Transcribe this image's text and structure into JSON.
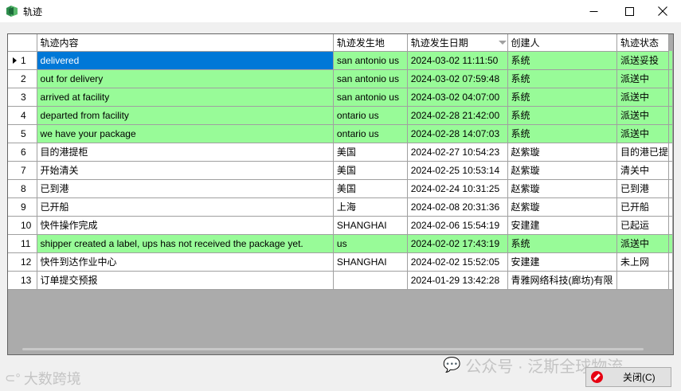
{
  "window": {
    "title": "轨迹"
  },
  "grid": {
    "columns": [
      "轨迹内容",
      "轨迹发生地",
      "轨迹发生日期",
      "创建人",
      "轨迹状态"
    ],
    "rows": [
      {
        "num": "1",
        "content": "delivered",
        "place": "san antonio us",
        "date": "2024-03-02 11:11:50",
        "creator": "系统",
        "status": "派送妥投"
      },
      {
        "num": "2",
        "content": "out for delivery",
        "place": "san antonio us",
        "date": "2024-03-02 07:59:48",
        "creator": "系统",
        "status": "派送中"
      },
      {
        "num": "3",
        "content": "arrived at facility",
        "place": "san antonio us",
        "date": "2024-03-02 04:07:00",
        "creator": "系统",
        "status": "派送中"
      },
      {
        "num": "4",
        "content": "departed from facility",
        "place": "ontario us",
        "date": "2024-02-28 21:42:00",
        "creator": "系统",
        "status": "派送中"
      },
      {
        "num": "5",
        "content": "we have your package",
        "place": "ontario us",
        "date": "2024-02-28 14:07:03",
        "creator": "系统",
        "status": "派送中"
      },
      {
        "num": "6",
        "content": "目的港提柜",
        "place": "美国",
        "date": "2024-02-27 10:54:23",
        "creator": "赵紫璇",
        "status": "目的港已提"
      },
      {
        "num": "7",
        "content": "开始清关",
        "place": "美国",
        "date": "2024-02-25 10:53:14",
        "creator": "赵紫璇",
        "status": "清关中"
      },
      {
        "num": "8",
        "content": "已到港",
        "place": "美国",
        "date": "2024-02-24 10:31:25",
        "creator": "赵紫璇",
        "status": "已到港"
      },
      {
        "num": "9",
        "content": "已开船",
        "place": "上海",
        "date": "2024-02-08 20:31:36",
        "creator": "赵紫璇",
        "status": "已开船"
      },
      {
        "num": "10",
        "content": "快件操作完成",
        "place": "SHANGHAI",
        "date": "2024-02-06 15:54:19",
        "creator": "安建建",
        "status": "已起运"
      },
      {
        "num": "11",
        "content": "shipper created a label, ups has not received the package yet.",
        "place": " us",
        "date": "2024-02-02 17:43:19",
        "creator": "系统",
        "status": "派送中"
      },
      {
        "num": "12",
        "content": "快件到达作业中心",
        "place": "SHANGHAI",
        "date": "2024-02-02 15:52:05",
        "creator": "安建建",
        "status": "未上网"
      },
      {
        "num": "13",
        "content": "订单提交预报",
        "place": "",
        "date": "2024-01-29 13:42:28",
        "creator": "青雅网络科技(廊坊)有限",
        "status": ""
      }
    ]
  },
  "footer": {
    "close_label": "关闭(C)",
    "watermark_right": "公众号 · 泛斯全球物流",
    "watermark_left": "大数跨境"
  },
  "colors": {
    "highlight_row": "#98fb98",
    "selection": "#0078d7"
  }
}
